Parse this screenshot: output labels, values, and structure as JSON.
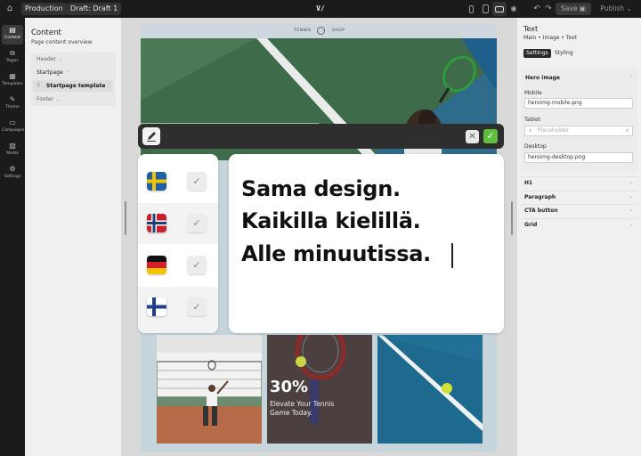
{
  "topbar": {
    "environment": "Production",
    "draft": "Draft: Draft 1",
    "logo": "V/",
    "save_label": "Save",
    "publish_label": "Publish"
  },
  "rail": [
    {
      "label": "Content",
      "icon": "document-icon"
    },
    {
      "label": "Pages",
      "icon": "pages-icon"
    },
    {
      "label": "Templates",
      "icon": "templates-icon"
    },
    {
      "label": "Theme",
      "icon": "brush-icon"
    },
    {
      "label": "Campaigns",
      "icon": "campaigns-icon"
    },
    {
      "label": "Media",
      "icon": "image-icon"
    },
    {
      "label": "Settings",
      "icon": "gear-icon"
    }
  ],
  "content_panel": {
    "title": "Content",
    "subtitle": "Page content overview",
    "tree": {
      "header": "Header",
      "startpage": "Startpage",
      "template": "Startpage template",
      "footer": "Footer"
    }
  },
  "site": {
    "nav_left": "TENNIS",
    "nav_right": "SHOP",
    "promo_percent": "30%",
    "promo_line1": "Elevate Your Tennis",
    "promo_line2": "Game Today."
  },
  "languages": [
    {
      "name": "Swedish",
      "flag": "sweden-flag-icon"
    },
    {
      "name": "Norwegian",
      "flag": "norway-flag-icon"
    },
    {
      "name": "German",
      "flag": "germany-flag-icon"
    },
    {
      "name": "Finnish",
      "flag": "finland-flag-icon"
    }
  ],
  "editor": {
    "line1": "Sama design.",
    "line2": "Kaikilla kielillä.",
    "line3": "Alle minuutissa."
  },
  "right_panel": {
    "title": "Text",
    "breadcrumb": {
      "main": "Main",
      "image": "Image",
      "text": "Text"
    },
    "tab_settings": "Settings",
    "tab_styling": "Styling",
    "hero_section": "Hero image",
    "mobile_label": "Mobile",
    "mobile_value": "heroimg-mobile.png",
    "tablet_label": "Tablet",
    "tablet_placeholder": "Placeholder",
    "desktop_label": "Desktop",
    "desktop_value": "heroimg-desktop.png",
    "sections": [
      "H1",
      "Paragraph",
      "CTA button",
      "Grid"
    ]
  },
  "colors": {
    "topbar": "#1b1b1b",
    "accent_ok": "#5fbf3c",
    "court_blue": "#1e5f8c",
    "court_green": "#3e6b4a",
    "clay": "#b56a48"
  }
}
